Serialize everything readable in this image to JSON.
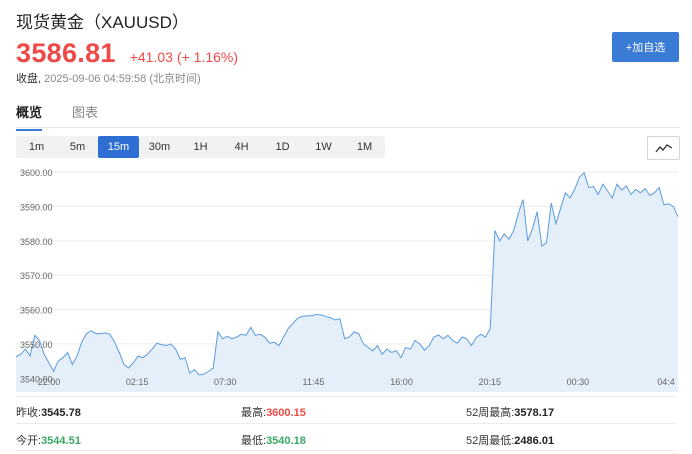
{
  "header": {
    "title": "现货黄金（XAUUSD）",
    "price": "3586.81",
    "change": "+41.03",
    "change_pct": "(+ 1.16%)",
    "status_label": "收盘,",
    "timestamp": "2025-09-06 04:59:58 (北京时间)",
    "add_button": "+加自选"
  },
  "tabs": [
    {
      "label": "概览",
      "active": true
    },
    {
      "label": "图表",
      "active": false
    }
  ],
  "intervals": [
    "1m",
    "5m",
    "15m",
    "30m",
    "1H",
    "4H",
    "1D",
    "1W",
    "1M"
  ],
  "selected_interval": "15m",
  "chart_type_icon": "line-chart-icon",
  "colors": {
    "up": "#ee4a47",
    "down": "#39a865",
    "accent": "#2f6fd4",
    "line": "#5b9be0",
    "area": "#e4effa"
  },
  "chart_data": {
    "type": "area",
    "y_ticks": [
      "3600.00",
      "3590.00",
      "3580.00",
      "3570.00",
      "3560.00",
      "3550.00",
      "3540.00"
    ],
    "ylim": [
      3536.0,
      3601.2
    ],
    "x_ticks": [
      "22:00",
      "02:15",
      "07:30",
      "11:45",
      "16:00",
      "20:15",
      "00:30",
      "04:4"
    ],
    "grid": true,
    "values": [
      3546.2,
      3547.0,
      3548.5,
      3546.5,
      3552.5,
      3551.0,
      3547.0,
      3544.5,
      3542.0,
      3545.0,
      3546.0,
      3547.5,
      3544.0,
      3546.5,
      3550.5,
      3553.0,
      3553.8,
      3553.0,
      3553.0,
      3553.2,
      3552.8,
      3550.5,
      3547.5,
      3544.0,
      3543.0,
      3544.5,
      3546.5,
      3546.0,
      3547.0,
      3548.5,
      3550.2,
      3549.8,
      3549.5,
      3550.0,
      3548.5,
      3545.5,
      3546.0,
      3541.5,
      3542.5,
      3541.0,
      3541.2,
      3542.0,
      3543.0,
      3553.5,
      3551.5,
      3552.2,
      3551.5,
      3552.0,
      3552.8,
      3552.5,
      3554.8,
      3552.5,
      3552.8,
      3552.0,
      3550.2,
      3550.5,
      3549.5,
      3552.0,
      3554.5,
      3556.0,
      3557.5,
      3558.0,
      3558.2,
      3558.2,
      3558.6,
      3558.4,
      3558.0,
      3557.6,
      3557.0,
      3557.3,
      3551.5,
      3552.0,
      3553.5,
      3553.0,
      3550.0,
      3549.0,
      3548.0,
      3549.5,
      3547.0,
      3548.5,
      3547.5,
      3548.0,
      3546.0,
      3549.0,
      3548.5,
      3551.0,
      3550.0,
      3548.2,
      3549.5,
      3552.0,
      3552.6,
      3551.5,
      3552.5,
      3551.0,
      3550.2,
      3552.0,
      3551.5,
      3549.5,
      3551.8,
      3552.8,
      3552.0,
      3554.5,
      3583.0,
      3580.0,
      3582.0,
      3580.5,
      3583.0,
      3588.0,
      3592.0,
      3580.0,
      3583.5,
      3588.5,
      3578.5,
      3579.5,
      3591.0,
      3585.0,
      3589.5,
      3594.0,
      3592.5,
      3595.0,
      3598.5,
      3599.8,
      3595.5,
      3595.8,
      3593.5,
      3596.5,
      3594.5,
      3592.5,
      3596.5,
      3594.8,
      3596.0,
      3593.5,
      3595.0,
      3594.0,
      3595.2,
      3593.2,
      3594.0,
      3595.5,
      3590.5,
      3590.8,
      3590.0,
      3587.0
    ]
  },
  "stats": [
    {
      "label": "昨收:",
      "value": "3545.78",
      "color": "dark"
    },
    {
      "label": "最高:",
      "value": "3600.15",
      "color": "red"
    },
    {
      "label": "52周最高:",
      "value": "3578.17",
      "color": "dark"
    },
    {
      "label": "今开:",
      "value": "3544.51",
      "color": "green"
    },
    {
      "label": "最低:",
      "value": "3540.18",
      "color": "green"
    },
    {
      "label": "52周最低:",
      "value": "2486.01",
      "color": "dark"
    }
  ]
}
